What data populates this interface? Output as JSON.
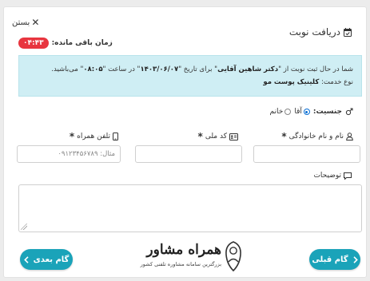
{
  "header": {
    "title": "دریافت نوبت",
    "close_label": "بستن",
    "timer_label": "زمان باقی مانده:",
    "timer_value": "۰۴:۴۳"
  },
  "info": {
    "line1_a": "شما در حال ثبت نوبت از \"",
    "doctor": "دکتر شاهین آقایی",
    "line1_b": "\" برای تاریخ \"",
    "date": "۱۴۰۳/۰۶/۰۷",
    "line1_c": "\" در ساعت \"",
    "time": "۰۸:۰۵",
    "line1_d": "\" می‌باشید.",
    "line2_a": "نوع خدمت: ",
    "service": "کلینیک پوست مو"
  },
  "gender": {
    "label": "جنسیت:",
    "options": [
      {
        "label": "آقا",
        "selected": true
      },
      {
        "label": "خانم",
        "selected": false
      }
    ]
  },
  "fields": {
    "name_label": "نام و نام خانوادگی",
    "national_id_label": "کد ملی",
    "phone_label": "تلفن همراه",
    "phone_placeholder": "مثال: ۰۹۱۲۳۴۵۶۷۸۹",
    "description_label": "توضیحات"
  },
  "buttons": {
    "next_label": "گام بعدی",
    "prev_label": "گام قبلی"
  },
  "logo": {
    "word": "همراه مشاور",
    "tagline": "بزرگترین سامانه مشاوره تلفنی کشور"
  },
  "colors": {
    "accent": "#1aa3b9",
    "timer": "#e8353f",
    "info_bg": "#cfeef4"
  }
}
